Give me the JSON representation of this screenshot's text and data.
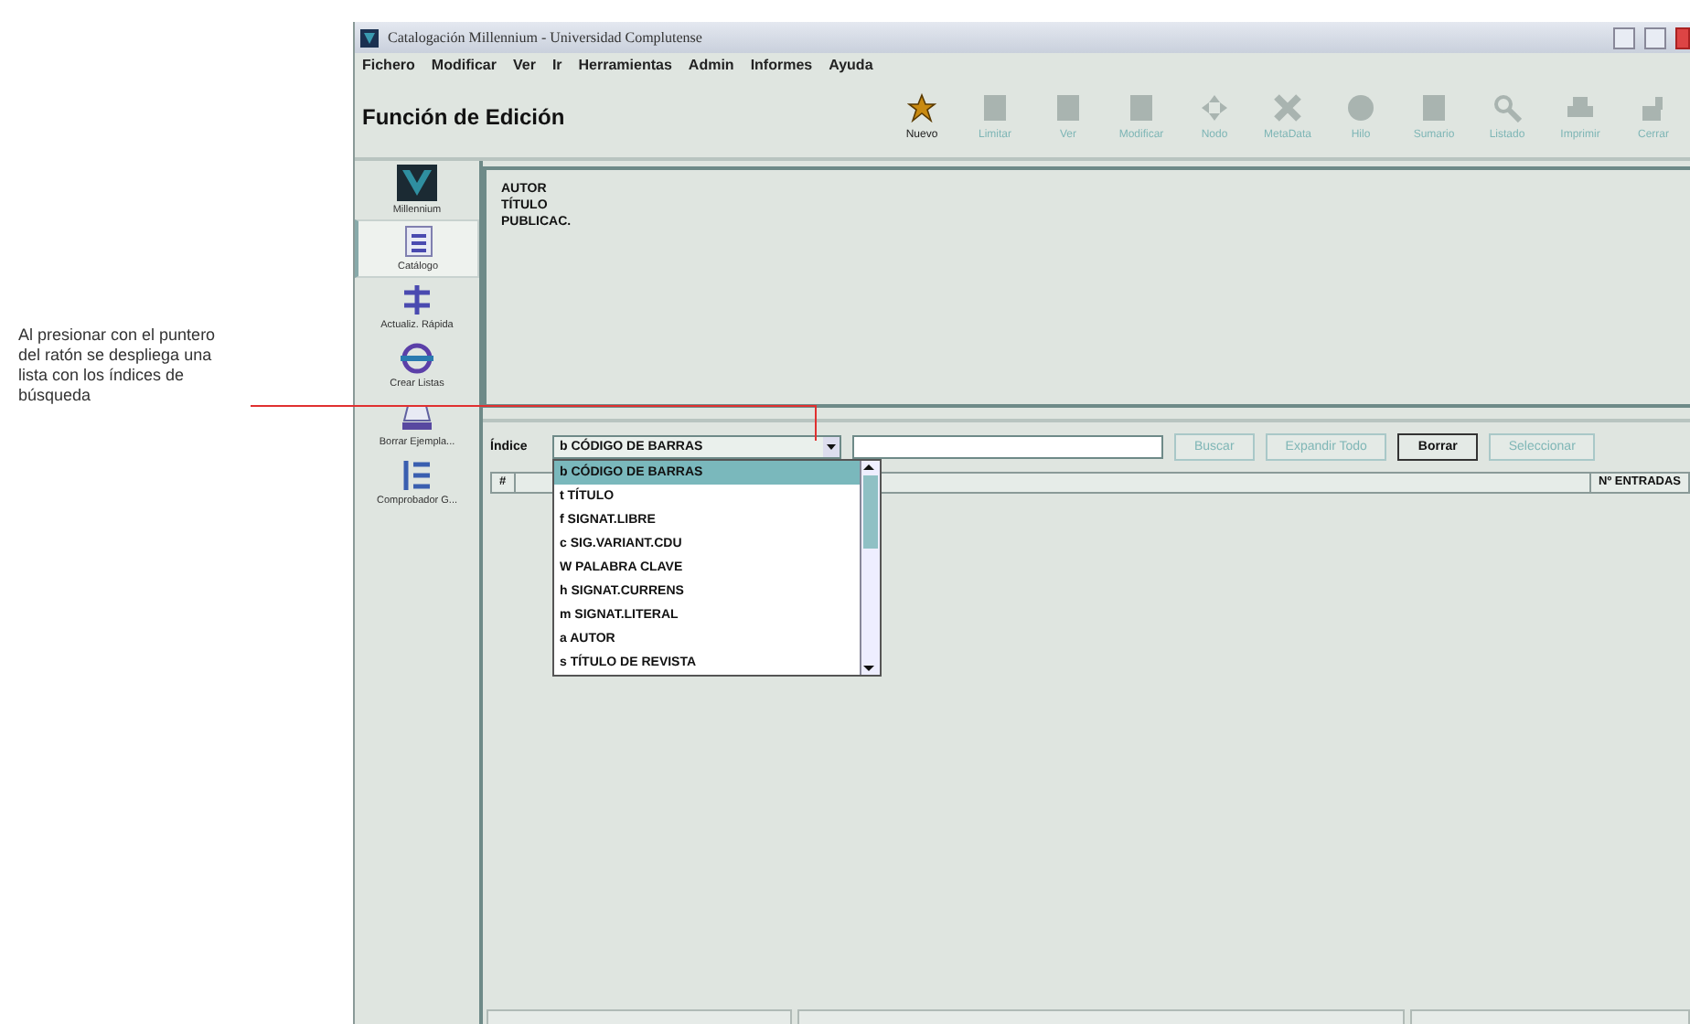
{
  "annotation": {
    "text": "Al presionar con el puntero del ratón se despliega una lista con los índices de búsqueda"
  },
  "window": {
    "title": "Catalogación Millennium - Universidad Complutense"
  },
  "menu": [
    "Fichero",
    "Modificar",
    "Ver",
    "Ir",
    "Herramientas",
    "Admin",
    "Informes",
    "Ayuda"
  ],
  "toolbar": {
    "title": "Función de Edición",
    "buttons": [
      {
        "label": "Nuevo",
        "disabled": false
      },
      {
        "label": "Limitar",
        "disabled": true
      },
      {
        "label": "Ver",
        "disabled": true
      },
      {
        "label": "Modificar",
        "disabled": true
      },
      {
        "label": "Nodo",
        "disabled": true
      },
      {
        "label": "MetaData",
        "disabled": true
      },
      {
        "label": "Hilo",
        "disabled": true
      },
      {
        "label": "Sumario",
        "disabled": true
      },
      {
        "label": "Listado",
        "disabled": true
      },
      {
        "label": "Imprimir",
        "disabled": true
      },
      {
        "label": "Cerrar",
        "disabled": true
      }
    ]
  },
  "sidebar": {
    "items": [
      {
        "label": "Millennium",
        "selected": false
      },
      {
        "label": "Catálogo",
        "selected": true
      },
      {
        "label": "Actualiz. Rápida",
        "selected": false
      },
      {
        "label": "Crear Listas",
        "selected": false
      },
      {
        "label": "Borrar Ejempla...",
        "selected": false
      },
      {
        "label": "Comprobador G...",
        "selected": false
      }
    ]
  },
  "record": {
    "lines": [
      "AUTOR",
      "TÍTULO",
      "PUBLICAC."
    ]
  },
  "search": {
    "index_label": "Índice",
    "index_value": "b CÓDIGO DE BARRAS",
    "buttons": [
      {
        "label": "Buscar",
        "disabled": true
      },
      {
        "label": "Expandir Todo",
        "disabled": true
      },
      {
        "label": "Borrar",
        "disabled": false
      },
      {
        "label": "Seleccionar",
        "disabled": true
      }
    ],
    "dropdown": {
      "options": [
        {
          "label": "b CÓDIGO DE BARRAS",
          "selected": true
        },
        {
          "label": "t TÍTULO",
          "selected": false
        },
        {
          "label": "f SIGNAT.LIBRE",
          "selected": false
        },
        {
          "label": "c SIG.VARIANT.CDU",
          "selected": false
        },
        {
          "label": "W PALABRA CLAVE",
          "selected": false
        },
        {
          "label": "h SIGNAT.CURRENS",
          "selected": false
        },
        {
          "label": "m SIGNAT.LITERAL",
          "selected": false
        },
        {
          "label": "a AUTOR",
          "selected": false
        },
        {
          "label": "s TÍTULO DE REVISTA",
          "selected": false
        }
      ]
    }
  },
  "results": {
    "columns": [
      "#",
      "Nº ENTRADAS"
    ]
  }
}
